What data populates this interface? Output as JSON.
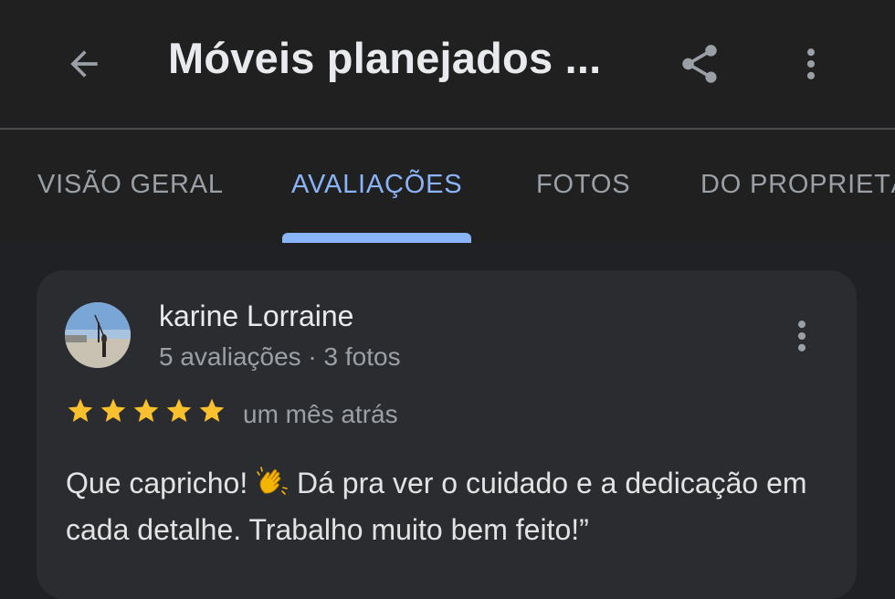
{
  "header": {
    "title": "Móveis planejados ...",
    "back_icon": "arrow-back-icon",
    "share_icon": "share-icon",
    "more_icon": "more-vert-icon"
  },
  "tabs": [
    {
      "label": "VISÃO GERAL",
      "active": false
    },
    {
      "label": "AVALIAÇÕES",
      "active": true
    },
    {
      "label": "FOTOS",
      "active": false
    },
    {
      "label": "DO PROPRIETÁRIO",
      "active": false
    }
  ],
  "review": {
    "reviewer_name": "karine Lorraine",
    "reviewer_meta": "5 avaliações · 3 fotos",
    "rating": 5,
    "rating_max": 5,
    "date": "um mês atrás",
    "text_before_emoji": "Que capricho! ",
    "emoji": "👏",
    "text_after_emoji": " Dá pra ver o cuidado e a dedicação em cada detalhe. Trabalho muito bem feito!”"
  },
  "colors": {
    "background": "#202124",
    "app_bar": "#202020",
    "card": "#2b2c2f",
    "accent": "#8ab4f8",
    "star": "#fbc02d",
    "text_primary": "#e8eaed",
    "text_secondary": "#9aa0a6"
  }
}
